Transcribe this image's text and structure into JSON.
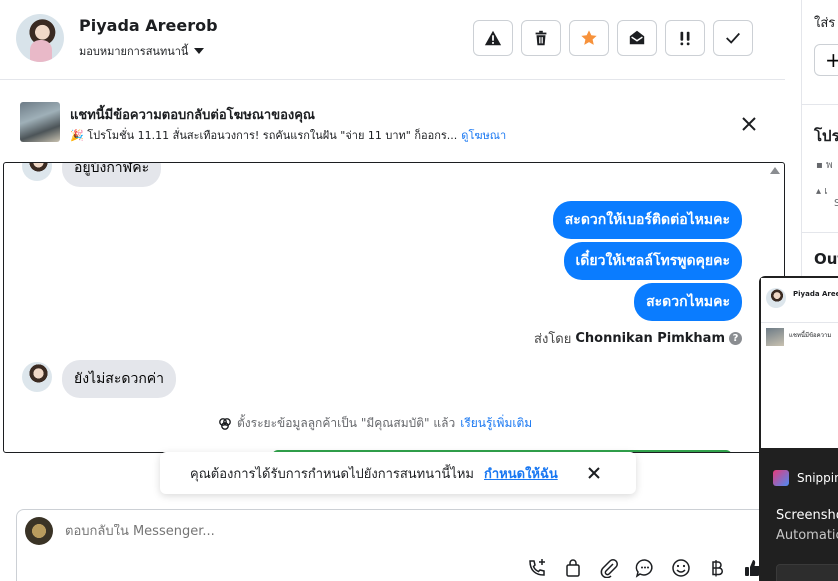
{
  "header": {
    "contact_name": "Piyada Areerob",
    "assign_label": "มอบหมายการสนทนานี้",
    "actions": [
      {
        "icon": "warning-icon",
        "label": "spam"
      },
      {
        "icon": "trash-icon",
        "label": "delete"
      },
      {
        "icon": "star-icon",
        "label": "follow-up"
      },
      {
        "icon": "mail-open-icon",
        "label": "mark-unread"
      },
      {
        "icon": "priority-icon",
        "label": "priority"
      },
      {
        "icon": "check-icon",
        "label": "done"
      }
    ],
    "star_color": "#f7923b"
  },
  "ad": {
    "title": "แชทนี้มีข้อความตอบกลับต่อโฆษณาของคุณ",
    "description": "🎉 โปรโมชั่น 11.11 สั่นสะเทือนวงการ! รถคันแรกในฝัน \"จ่าย 11 บาท\" ก็ออกร...",
    "link": "ดูโฆษณา"
  },
  "messages": {
    "incoming_top": "อยู่บ้งกาฬคะ",
    "outgoing": [
      "สะดวกให้เบอร์ติดต่อไหมคะ",
      "เดี๋ยวให้เซลล์โทรพูดคุยคะ",
      "สะดวกไหมคะ"
    ],
    "sent_by_prefix": "ส่งโดย",
    "sent_by_name": "Chonnikan Pimkham",
    "incoming_reply": "ยังไม่สะดวกค่า",
    "info_text": "ตั้งระยะข้อมูลลูกค้าเป็น \"มีคุณสมบัติ\" แล้ว",
    "info_link": "เรียนรู้เพิ่มเติม"
  },
  "toast": {
    "text": "คุณต้องการได้รับการกำหนดไปยังการสนทนานี้ไหม",
    "link": "กำหนดให้ฉัน"
  },
  "composer": {
    "placeholder": "ตอบกลับใน Messenger...",
    "tools": [
      "call-add-icon",
      "shopping-bag-icon",
      "paperclip-icon",
      "chat-bubble-icon",
      "emoji-icon",
      "baht-icon",
      "thumbs-up-icon"
    ]
  },
  "right_panel": {
    "top_text": "ใส่ร",
    "section1": "โปร",
    "section2": "Out",
    "row1": "พ",
    "row2": "เ",
    "row2b": "S"
  },
  "overlay": {
    "preview_name": "Piyada Areerob",
    "preview_ad": "แชทนี้มีข้อความ",
    "app_name": "Snipping Tool",
    "title": "Screenshot copied",
    "subtitle": "Automatically saved"
  },
  "colors": {
    "accent": "#1877f2",
    "outgoing_bubble": "#0a7cff",
    "incoming_bubble": "#e4e6eb",
    "qualified_green": "#31a24c"
  }
}
